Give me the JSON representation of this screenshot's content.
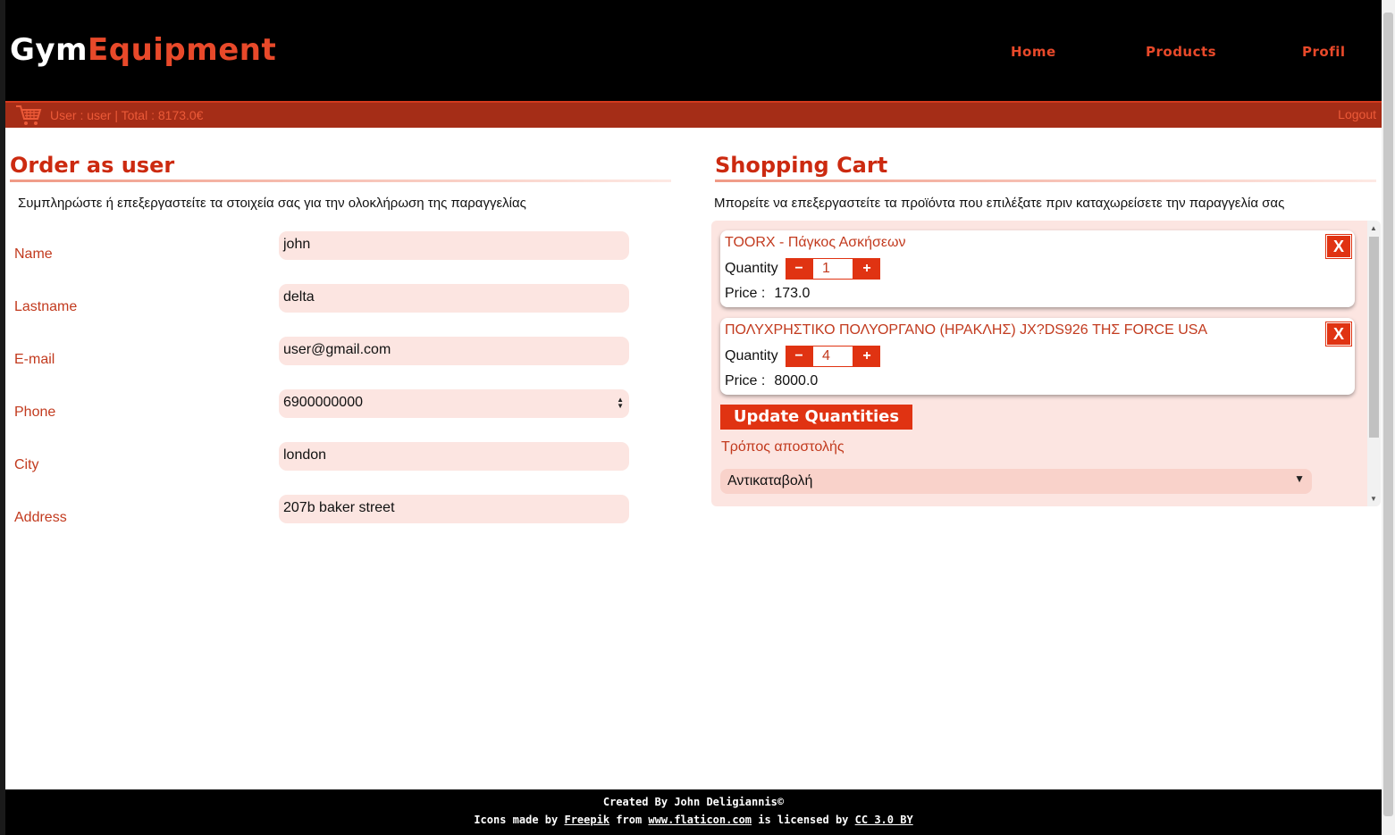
{
  "brand": {
    "part1": "Gym",
    "part2": "Equipment"
  },
  "nav": {
    "home": "Home",
    "products": "Products",
    "profile": "Profil"
  },
  "userbar": {
    "info": "User : user | Total : 8173.0€",
    "logout": "Logout"
  },
  "order": {
    "title": "Order as user",
    "description": "Συμπληρώστε ή επεξεργαστείτε τα στοιχεία σας για την ολοκλήρωση της παραγγελίας",
    "fields": [
      {
        "label": "Name",
        "value": "john"
      },
      {
        "label": "Lastname",
        "value": "delta"
      },
      {
        "label": "E-mail",
        "value": "user@gmail.com"
      },
      {
        "label": "Phone",
        "value": "6900000000"
      },
      {
        "label": "City",
        "value": "london"
      },
      {
        "label": "Address",
        "value": "207b baker street"
      }
    ]
  },
  "cart": {
    "title": "Shopping Cart",
    "description": "Μπορείτε να επεξεργαστείτε τα προϊόντα που επιλέξατε πριν καταχωρείσετε την παραγγελία σας",
    "quantity_label": "Quantity",
    "price_label": "Price :",
    "remove_symbol": "X",
    "minus_symbol": "−",
    "plus_symbol": "+",
    "items": [
      {
        "name": "TOORX - Πάγκος Ασκήσεων",
        "quantity": "1",
        "price": "173.0"
      },
      {
        "name": "ΠΟΛΥΧΡΗΣΤΙΚΟ ΠΟΛΥΟΡΓΑΝΟ (ΗΡΑΚΛΗΣ) JX?DS926 ΤΗΣ FORCE USA",
        "quantity": "4",
        "price": "8000.0"
      }
    ],
    "update_button": "Update Quantities",
    "shipping_label": "Τρόπος αποστολής",
    "shipping_selected": "Αντικαταβολή"
  },
  "footer": {
    "created_by": "Created By John Deligiannis©",
    "icons_prefix": "Icons made by",
    "freepik": "Freepik",
    "from": "from",
    "flaticon": "www.flaticon.com",
    "licensed": "is licensed by",
    "license": "CC 3.0 BY"
  },
  "colors": {
    "accent": "#e03312",
    "brand_orange": "#e8492a",
    "userbar": "#a52d17",
    "input_bg": "#fce5e1"
  },
  "icons": [
    "shopping-cart-icon",
    "close-icon",
    "chevron-down-icon"
  ]
}
